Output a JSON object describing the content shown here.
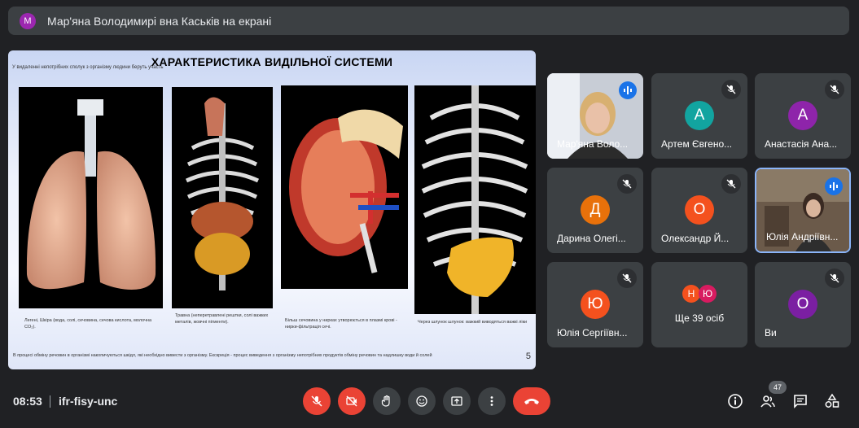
{
  "banner": {
    "avatar_letter": "M",
    "text": "Мар'яна Володимирі вна Каськів на екрані"
  },
  "slide": {
    "title": "ХАРАКТЕРИСТИКА ВИДІЛЬНОЇ СИСТЕМИ",
    "intro": "У видаленні непотрібних сполук з організму людини беруть участь",
    "captions": [
      "Легені,\nШкіра (вода, солі, сечовина, сечова кислота, молочна CO₂).",
      "Травна (неперетравлені рештки, солі важких металів, жовчні пігменти).",
      "Більш сечовина у нирках утворюється в плазмі крові - нирки-фільтрація сечі.",
      "Через шлунок шлунок: важкий виводяться важкі ліки"
    ],
    "footer": "В процесі обміну речовин в організмі накопичуються шкідл, які необхідно вивести з організму. Екскреція - процес виведення з організму непотрібних продуктів обміну речовин та надлишку води й солей",
    "page_number": "5"
  },
  "participants": [
    {
      "name": "Мар'яна Воло...",
      "type": "video",
      "speaking": true
    },
    {
      "name": "Артем Євгено...",
      "letter": "А",
      "color": "#12a4a0",
      "muted": true
    },
    {
      "name": "Анастасія Ана...",
      "letter": "А",
      "color": "#8e24aa",
      "muted": true
    },
    {
      "name": "Дарина Олегі...",
      "letter": "Д",
      "color": "#e8710a",
      "muted": true
    },
    {
      "name": "Олександр Й...",
      "letter": "О",
      "color": "#f4511e",
      "muted": true
    },
    {
      "name": "Юлія Андріївн...",
      "type": "video",
      "speaking": true
    },
    {
      "name": "Юлія Сергіївн...",
      "letter": "Ю",
      "color": "#f4511e",
      "muted": true
    },
    {
      "name": "Ще 39 осіб",
      "type": "others",
      "letters": [
        "Н",
        "Ю"
      ]
    },
    {
      "name": "Ви",
      "letter": "О",
      "color": "#7b1fa2",
      "muted": true
    }
  ],
  "bottom": {
    "time": "08:53",
    "meeting_code": "ifr-fisy-unc",
    "people_count": "47"
  }
}
